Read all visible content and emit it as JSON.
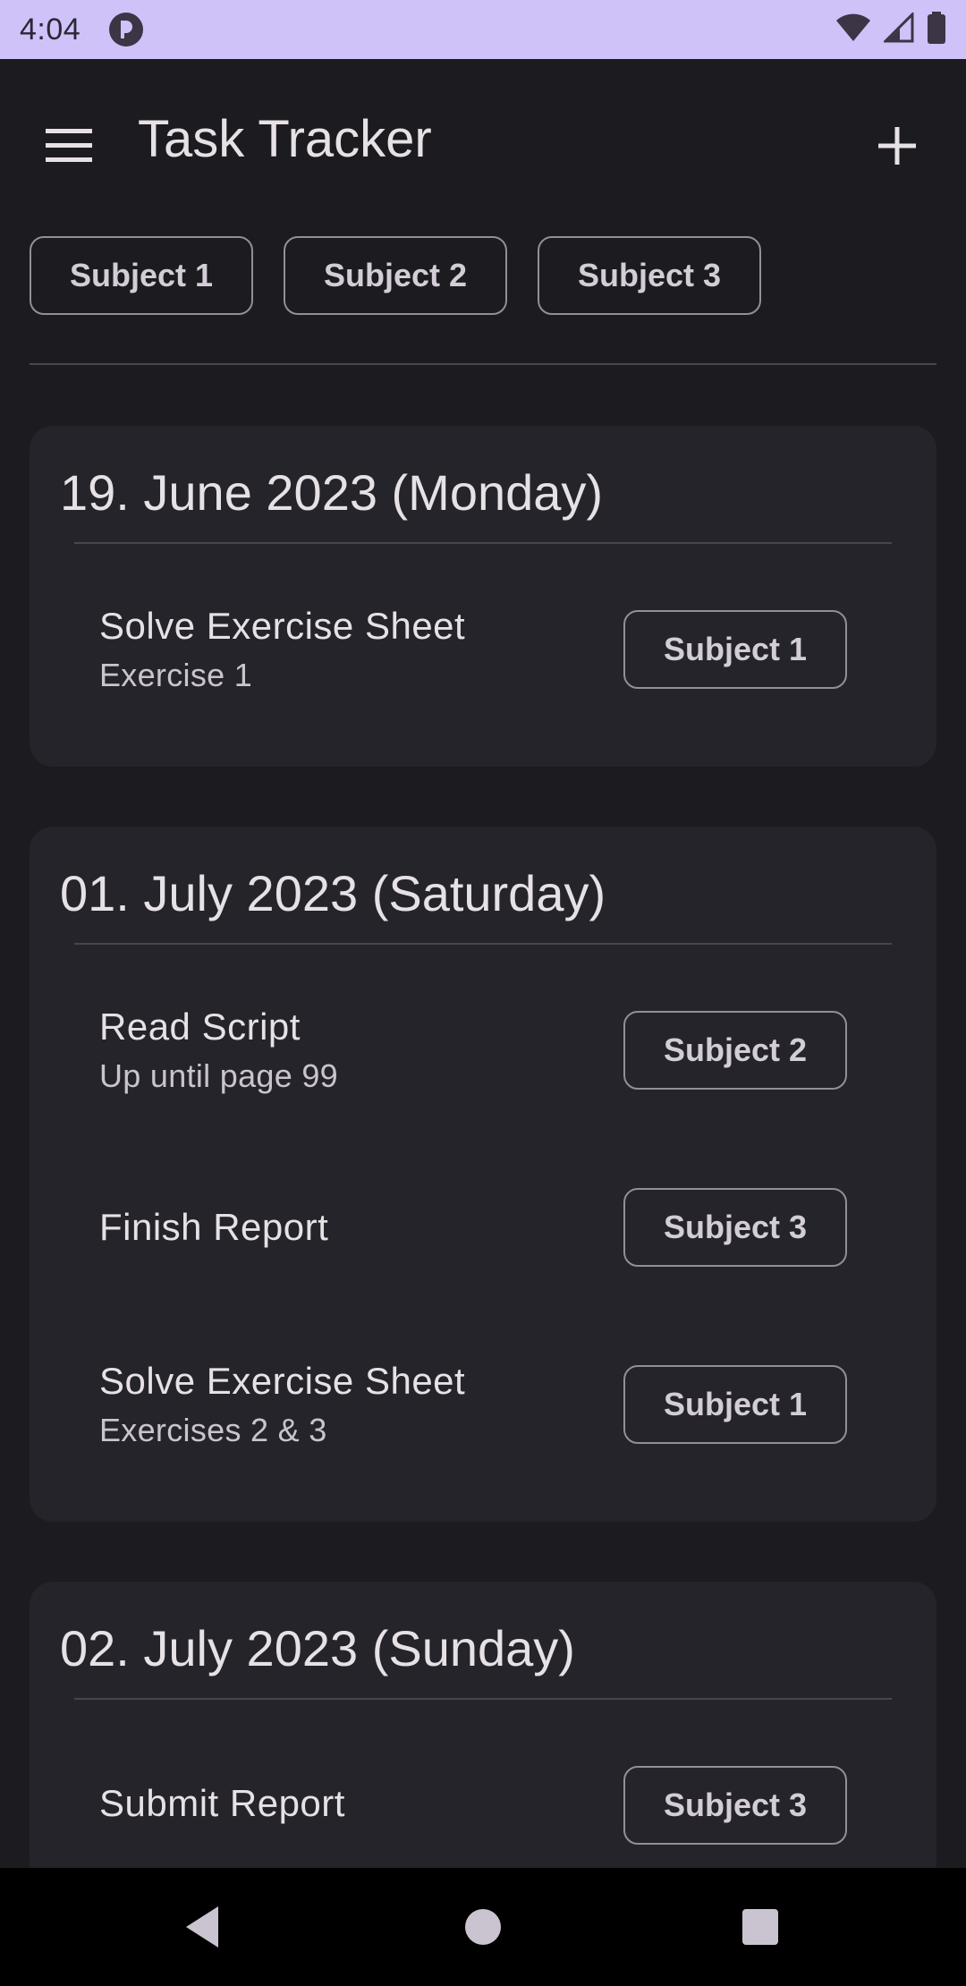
{
  "status_bar": {
    "time": "4:04"
  },
  "app_bar": {
    "title": "Task Tracker"
  },
  "filter_chips": [
    "Subject 1",
    "Subject 2",
    "Subject 3"
  ],
  "days": [
    {
      "date": "19. June 2023 (Monday)",
      "tasks": [
        {
          "title": "Solve Exercise Sheet",
          "subtitle": "Exercise 1",
          "subject": "Subject 1"
        }
      ]
    },
    {
      "date": "01. July 2023 (Saturday)",
      "tasks": [
        {
          "title": "Read Script",
          "subtitle": "Up until page 99",
          "subject": "Subject 2"
        },
        {
          "title": "Finish Report",
          "subtitle": "",
          "subject": "Subject 3"
        },
        {
          "title": "Solve Exercise Sheet",
          "subtitle": "Exercises 2 & 3",
          "subject": "Subject 1"
        }
      ]
    },
    {
      "date": "02. July 2023 (Sunday)",
      "tasks": [
        {
          "title": "Submit Report",
          "subtitle": "",
          "subject": "Subject 3"
        }
      ]
    }
  ],
  "colors": {
    "background": "#1c1b1f",
    "status_bar": "#cfc2f9",
    "card": "#25242a",
    "outline": "#938f99"
  }
}
